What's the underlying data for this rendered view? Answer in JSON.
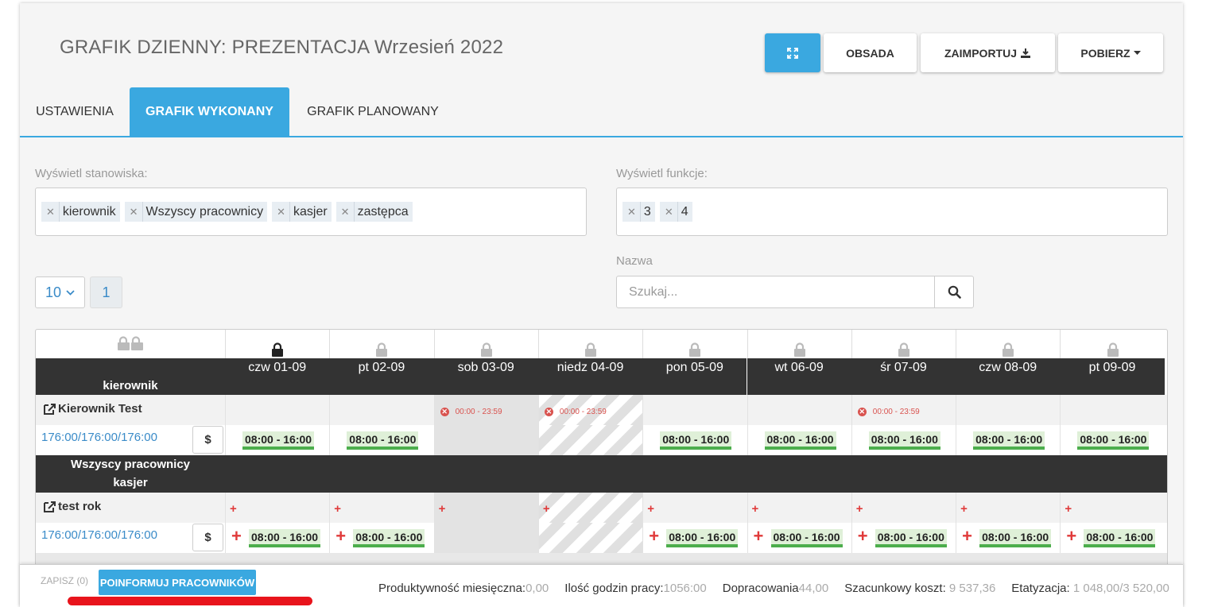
{
  "page_title": "GRAFIK DZIENNY: PREZENTACJA Wrzesień 2022",
  "toolbar": {
    "obsada_label": "OBSADA",
    "import_label": "ZAIMPORTUJ",
    "pobierz_label": "POBIERZ"
  },
  "tabs": [
    {
      "label": "USTAWIENIA"
    },
    {
      "label": "GRAFIK WYKONANY"
    },
    {
      "label": "GRAFIK PLANOWANY"
    }
  ],
  "filters": {
    "positions_label": "Wyświetl stanowiska:",
    "positions": [
      "kierownik",
      "Wszyscy pracownicy",
      "kasjer",
      "zastępca"
    ],
    "functions_label": "Wyświetl funkcje:",
    "functions": [
      "3",
      "4"
    ],
    "name_label": "Nazwa",
    "search_placeholder": "Szukaj..."
  },
  "pagination": {
    "page_size": "10",
    "page": "1"
  },
  "grid": {
    "days": [
      "czw 01-09",
      "pt 02-09",
      "sob 03-09",
      "niedz 04-09",
      "pon 05-09",
      "wt 06-09",
      "śr 07-09",
      "czw 08-09",
      "pt 09-09"
    ],
    "groups": [
      {
        "title": "kierownik",
        "employees": [
          {
            "name": "Kierownik Test",
            "hours": "176:00/176:00/176:00",
            "dollar": "$",
            "absences": [
              "",
              "",
              "00:00 - 23:59",
              "00:00 - 23:59",
              "",
              "",
              "00:00 - 23:59",
              "",
              ""
            ],
            "shifts": [
              "08:00 - 16:00",
              "08:00 - 16:00",
              "",
              "",
              "08:00 - 16:00",
              "08:00 - 16:00",
              "08:00 - 16:00",
              "08:00 - 16:00",
              "08:00 - 16:00"
            ]
          }
        ]
      },
      {
        "title": "Wszyscy pracownicy",
        "subtitle": "kasjer",
        "employees": [
          {
            "name": "test rok",
            "hours": "176:00/176:00/176:00",
            "dollar": "$",
            "shifts": [
              "08:00 - 16:00",
              "08:00 - 16:00",
              "",
              "",
              "08:00 - 16:00",
              "08:00 - 16:00",
              "08:00 - 16:00",
              "08:00 - 16:00",
              "08:00 - 16:00"
            ]
          }
        ]
      }
    ]
  },
  "footer": {
    "save_label": "ZAPISZ (0)",
    "inform_label": "POINFORMUJ PRACOWNIKÓW",
    "stats": [
      {
        "label": "Produktywność miesięczna:",
        "value": "0,00"
      },
      {
        "label": "Ilość godzin pracy:",
        "value": "1056:00"
      },
      {
        "label": "Dopracowania",
        "value": "44,00"
      },
      {
        "label": "Szacunkowy koszt: ",
        "value": "9 537,36"
      },
      {
        "label": "Etatyzacja: ",
        "value": "1 048,00/3 520,00"
      }
    ]
  },
  "colors": {
    "accent": "#3aa8e0",
    "header_dark": "#333333",
    "shift_bg": "#dff0d8",
    "shift_border": "#4cae4c",
    "absence": "#d9534f",
    "highlight": "#e8141c"
  }
}
